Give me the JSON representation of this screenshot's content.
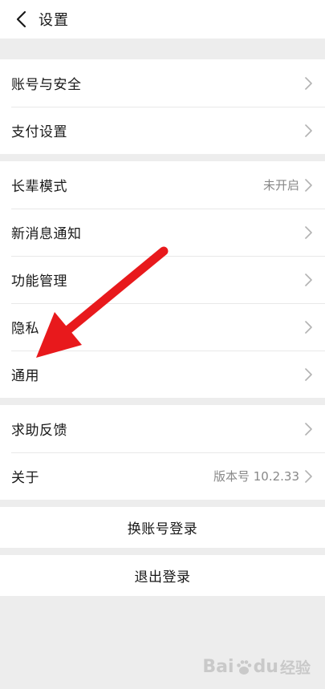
{
  "header": {
    "title": "设置",
    "back_icon": "chevron-left-icon"
  },
  "groups": [
    {
      "items": [
        {
          "label": "账号与安全",
          "value": ""
        },
        {
          "label": "支付设置",
          "value": ""
        }
      ]
    },
    {
      "items": [
        {
          "label": "长辈模式",
          "value": "未开启"
        },
        {
          "label": "新消息通知",
          "value": ""
        },
        {
          "label": "功能管理",
          "value": ""
        },
        {
          "label": "隐私",
          "value": ""
        },
        {
          "label": "通用",
          "value": ""
        }
      ]
    },
    {
      "items": [
        {
          "label": "求助反馈",
          "value": ""
        },
        {
          "label": "关于",
          "value": "版本号 10.2.33"
        }
      ]
    }
  ],
  "actions": {
    "switch_account": "换账号登录",
    "logout": "退出登录"
  },
  "annotation": {
    "arrow_color": "#e8191c",
    "arrow_target": "通用"
  },
  "watermark": {
    "brand_left": "Bai",
    "brand_right": "du",
    "suffix": "经验"
  },
  "colors": {
    "background": "#ededed",
    "surface": "#ffffff",
    "text": "#191919",
    "secondary_text": "#888888",
    "chevron": "#b2b2b2"
  }
}
